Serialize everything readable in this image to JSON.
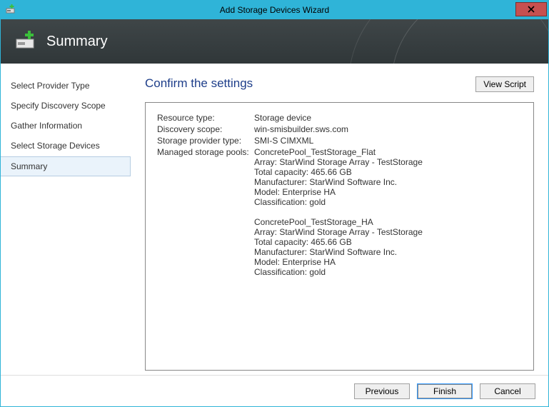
{
  "window": {
    "title": "Add Storage Devices Wizard"
  },
  "header": {
    "title": "Summary"
  },
  "sidebar": {
    "items": [
      {
        "label": "Select Provider Type"
      },
      {
        "label": "Specify Discovery Scope"
      },
      {
        "label": "Gather Information"
      },
      {
        "label": "Select Storage Devices"
      },
      {
        "label": "Summary"
      }
    ],
    "selectedIndex": 4
  },
  "main": {
    "heading": "Confirm the settings",
    "viewScriptLabel": "View Script",
    "rows": [
      {
        "label": "Resource type:",
        "value": "Storage device"
      },
      {
        "label": "Discovery scope:",
        "value": "win-smisbuilder.sws.com"
      },
      {
        "label": "Storage provider type:",
        "value": "SMI-S CIMXML"
      },
      {
        "label": "Managed storage pools:",
        "value": "ConcretePool_TestStorage_Flat\nArray: StarWind Storage Array - TestStorage\nTotal capacity: 465.66 GB\nManufacturer: StarWind Software Inc.\nModel: Enterprise HA\nClassification: gold\n\nConcretePool_TestStorage_HA\nArray: StarWind Storage Array - TestStorage\nTotal capacity: 465.66 GB\nManufacturer: StarWind Software Inc.\nModel: Enterprise HA\nClassification: gold"
      }
    ]
  },
  "footer": {
    "previous": "Previous",
    "finish": "Finish",
    "cancel": "Cancel"
  }
}
